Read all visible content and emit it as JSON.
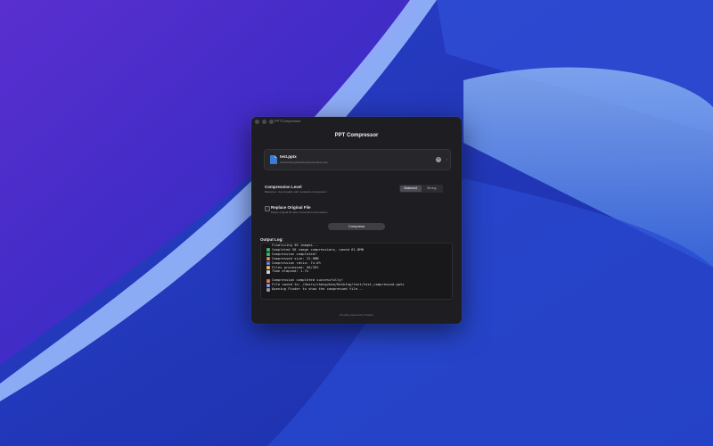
{
  "window": {
    "title": "PPTCompressor"
  },
  "app": {
    "title": "PPT Compressor"
  },
  "file": {
    "name": "test.pptx",
    "path": "/Users/chengzhao/Desktop/test/test.pptx",
    "close_glyph": "×",
    "chevron": "›"
  },
  "compression": {
    "label": "Compression Level",
    "description": "Balanced - Good quality with moderate compression",
    "options": [
      "Balanced",
      "Strong"
    ],
    "selected": "Balanced"
  },
  "replace": {
    "label": "Replace Original File",
    "description": "Delete original file after successful compression",
    "checked": false
  },
  "actions": {
    "compress_label": "Compress"
  },
  "log": {
    "label": "Output Log:",
    "lines": [
      {
        "text": "Finalizing 56 images...",
        "icon": ""
      },
      {
        "text": "Completed 56 image compressions, saved 61.8MB",
        "icon": "check-icon"
      },
      {
        "text": "Compression completed!",
        "icon": "check-icon"
      },
      {
        "text": "Compressed size: 22.0MB",
        "icon": "package-icon"
      },
      {
        "text": "Compression ratio: 74.8%",
        "icon": "chart-icon"
      },
      {
        "text": "Files processed: 56/392",
        "icon": "folder-icon"
      },
      {
        "text": "Time elapsed: 1.7s",
        "icon": "timer-icon"
      },
      {
        "text": "",
        "icon": ""
      },
      {
        "text": "Compression completed successfully!",
        "icon": "party-icon"
      },
      {
        "text": "File saved to: /Users/chengzhao/Desktop/test/test_compressed.pptx",
        "icon": "disk-icon"
      },
      {
        "text": "Opening Finder to show the compressed file...",
        "icon": "search-icon"
      }
    ]
  },
  "footer": {
    "text": "Proudly powered by Charles"
  },
  "colors": {
    "accent_blue": "#3a7bd5",
    "check_green": "#34a853",
    "window_bg": "#1e1e22"
  }
}
